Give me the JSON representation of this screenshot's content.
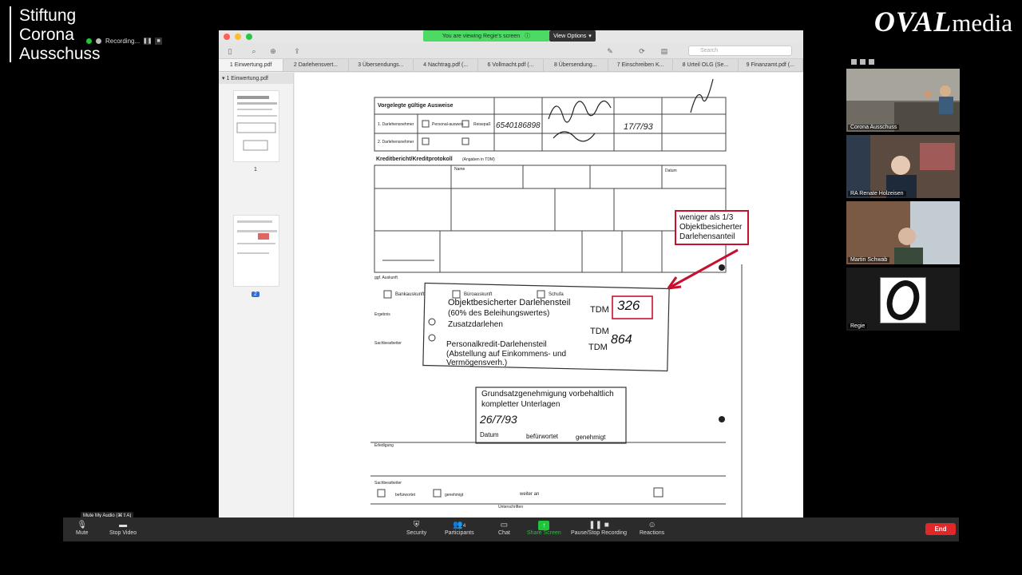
{
  "branding": {
    "left_lines": [
      "Stiftung",
      "Corona",
      "Ausschuss"
    ],
    "right_bold": "OVAL",
    "right_light": "media"
  },
  "recording": {
    "label": "Recording..."
  },
  "share": {
    "banner": "You are viewing Regie's screen",
    "view_options": "View Options",
    "search_placeholder": "Search"
  },
  "tabs": [
    "1 Einwertung.pdf",
    "2 Darlehensvert...",
    "3 Übersendungs...",
    "4 Nachtrag.pdf (...",
    "6 Vollmacht.pdf (...",
    "8 Übersendung...",
    "7 Einschreiben K...",
    "8 Urteil OLG (Se...",
    "9 Finanzamt.pdf (..."
  ],
  "sidebar": {
    "file": "1 Einwertung.pdf",
    "pages": [
      "1",
      "2"
    ]
  },
  "document": {
    "header_title": "Vorgelegte gültige Ausweise",
    "row_labels": [
      "1. Darlehensnehmer",
      "2. Darlehensnehmer"
    ],
    "option_labels": [
      "Personal-ausweis",
      "Reisepaß"
    ],
    "handwritten_id": "6540186898",
    "handwritten_date": "17/7/93",
    "section2": "Kreditbericht/Kreditprotokoll",
    "section2_sub": "(Angaben in TDM)",
    "col_name": "Name",
    "col_date": "Datum",
    "auskunft": "ggf. Auskunft",
    "ergebnis": "Ergebnis",
    "sachbearb": "Sachbearbeiter",
    "line1": "Objektbesicherter Darlehensteil",
    "line1_sub": "(60% des Beleihungswertes)",
    "line2": "Zusatzdarlehen",
    "line3": "Personalkredit-Darlehensteil",
    "line3_sub": "(Abstellung auf Einkommens- und",
    "line3_sub2": "Vermögensverh.)",
    "tdm": "TDM",
    "value1": "326",
    "value3": "864",
    "grundsatz_title": "Grundsatzgenehmigung vorbehaltlich",
    "grundsatz_sub": "kompletter Unterlagen",
    "grundsatz_date": "26/7/93",
    "datum": "Datum",
    "befuerwortet": "befürwortet",
    "genehmigt": "genehmigt",
    "schufa": "Schufa",
    "bankauskunft": "Bankauskunft",
    "buero": "Büroauskunft",
    "weiter": "weiter an",
    "unterschriften": "Unterschriften",
    "befuerw_checkbox": "befürwortet",
    "genehmigt_checkbox": "genehmigt",
    "erledigung": "Erledigung"
  },
  "annotation": [
    "weniger als 1/3",
    "Objektbesicherter",
    "Darlehensanteil"
  ],
  "participants": [
    {
      "name": "Corona Ausschuss"
    },
    {
      "name": "RA Renate Holzeisen"
    },
    {
      "name": "Martin Schwab"
    },
    {
      "name": "Regie"
    }
  ],
  "controls": {
    "tooltip": "Mute My Audio (⌘⇧A)",
    "mute": "Mute",
    "stop_video": "Stop Video",
    "security": "Security",
    "participants": "Participants",
    "participants_count": "4",
    "chat": "Chat",
    "share_screen": "Share Screen",
    "pause_record": "Pause/Stop Recording",
    "reactions": "Reactions",
    "end": "End"
  },
  "colors": {
    "accent_green": "#1ec53a",
    "annotation_red": "#c8102e",
    "end_red": "#e02828"
  }
}
